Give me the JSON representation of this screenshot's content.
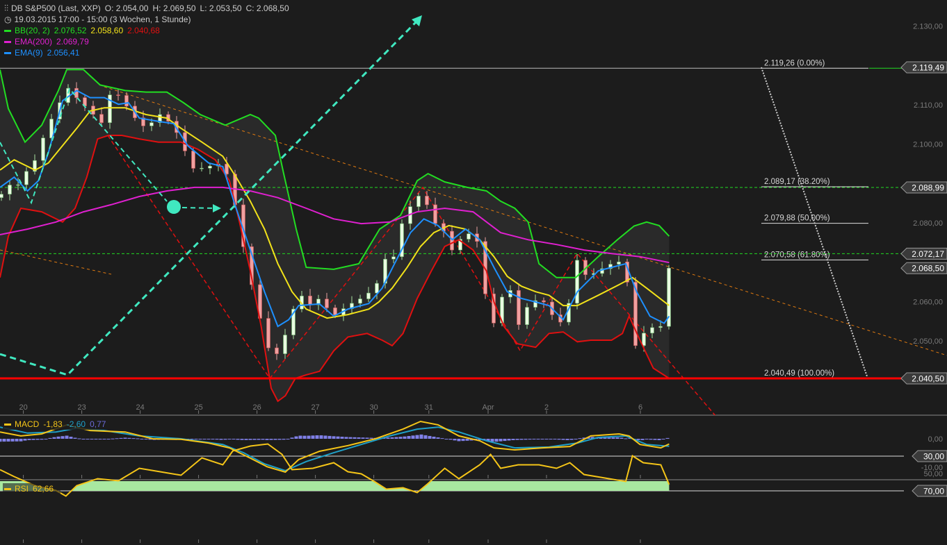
{
  "header": {
    "instrument": "DB S&P500 (Last, XXP)",
    "open": "O: 2.054,00",
    "high": "H: 2.069,50",
    "low": "L: 2.053,50",
    "close": "C: 2.068,50",
    "period": "19.03.2015 17:00 - 15:00 (3 Wochen, 1 Stunde)"
  },
  "indicators": {
    "bb": {
      "label": "BB(20, 2)",
      "upper": "2.076,52",
      "mid": "2.058,60",
      "lower": "2.040,68"
    },
    "ema200": {
      "label": "EMA(200)",
      "value": "2.069,79"
    },
    "ema9": {
      "label": "EMA(9)",
      "value": "2.056,41"
    },
    "macd": {
      "label": "MACD",
      "macd": "-1,83",
      "signal": "-2,60",
      "hist": "0,77"
    },
    "rsi": {
      "label": "RSI",
      "value": "62,66"
    }
  },
  "colors": {
    "bg": "#1c1c1c",
    "bb_upper": "#22dd22",
    "bb_mid": "#f2e21a",
    "bb_lower": "#e01010",
    "ema200": "#e020d0",
    "ema9": "#1e90ff",
    "macd": "#f5c518",
    "signal": "#1fa0c8",
    "hist": "#8080e8",
    "rsi": "#f5c518",
    "cyan": "#40e8c0"
  },
  "price_axis": {
    "ticks": [
      "2.130,00",
      "2.110,00",
      "2.100,00",
      "2.080,00",
      "2.060,00",
      "2.050,00"
    ],
    "tick_values": [
      2130,
      2110,
      2100,
      2080,
      2060,
      2050
    ]
  },
  "price_tags": [
    {
      "text": "2.119,49",
      "value": 2119.49
    },
    {
      "text": "2.088,99",
      "value": 2088.99
    },
    {
      "text": "2.072,17",
      "value": 2072.17
    },
    {
      "text": "2.068,50",
      "value": 2068.5
    },
    {
      "text": "2.040,50",
      "value": 2040.5
    }
  ],
  "fib_levels": [
    {
      "text": "2.119,26 (0.00%)",
      "value": 2119.26
    },
    {
      "text": "2.089,17 (38.20%)",
      "value": 2089.17
    },
    {
      "text": "2.079,88 (50,00%)",
      "value": 2079.88
    },
    {
      "text": "2.070,58 (61.80%)",
      "value": 2070.58
    },
    {
      "text": "2.040,49 (100.00%)",
      "value": 2040.49
    }
  ],
  "x_axis": {
    "labels": [
      "20",
      "23",
      "24",
      "25",
      "26",
      "27",
      "30",
      "31",
      "Apr",
      "2",
      "6"
    ],
    "label_bars": [
      2.8,
      9.8,
      16.8,
      23.8,
      30.8,
      37.8,
      44.8,
      51.4,
      58.5,
      65.5,
      76.75
    ]
  },
  "macd_axis": {
    "ticks": [
      "0,00",
      "-10,00"
    ],
    "tick_values": [
      0,
      -10
    ]
  },
  "rsi_axis": {
    "ticks": [
      "70,00",
      "50,00",
      "30,00"
    ],
    "tick_values": [
      70,
      50,
      30
    ]
  },
  "chart_data": {
    "type": "line",
    "title": "DB S&P500 (Last, XXP) 1h",
    "x_unit": "bar (1 hour)",
    "ylim": [
      2031,
      2135
    ],
    "bb_upper": [
      [
        0,
        2118.9
      ],
      [
        1,
        2109
      ],
      [
        3,
        2100.5
      ],
      [
        5,
        2104.8
      ],
      [
        7,
        2113.6
      ],
      [
        8,
        2118.9
      ],
      [
        10,
        2118.9
      ],
      [
        12,
        2115
      ],
      [
        15,
        2113.6
      ],
      [
        17.5,
        2113.2
      ],
      [
        20,
        2113.2
      ],
      [
        22,
        2110.5
      ],
      [
        24,
        2107.5
      ],
      [
        27,
        2104.8
      ],
      [
        29,
        2106.6
      ],
      [
        30,
        2107.5
      ],
      [
        31,
        2106.6
      ],
      [
        33,
        2102.2
      ],
      [
        34,
        2092.5
      ],
      [
        35.5,
        2078.4
      ],
      [
        36.7,
        2068.7
      ],
      [
        40,
        2068.2
      ],
      [
        43,
        2069.6
      ],
      [
        45.5,
        2078.4
      ],
      [
        48,
        2081.9
      ],
      [
        50,
        2090.7
      ],
      [
        51.3,
        2092.5
      ],
      [
        53.3,
        2090.4
      ],
      [
        56,
        2089
      ],
      [
        58.3,
        2088.1
      ],
      [
        60,
        2085.5
      ],
      [
        61.7,
        2083.7
      ],
      [
        63.3,
        2080.2
      ],
      [
        64.6,
        2069.6
      ],
      [
        66.7,
        2066.1
      ],
      [
        69,
        2066.1
      ],
      [
        71.7,
        2071.4
      ],
      [
        74,
        2075.7
      ],
      [
        76,
        2079.2
      ],
      [
        77.5,
        2080.2
      ],
      [
        79,
        2079.3
      ],
      [
        80.2,
        2076.6
      ]
    ],
    "bb_lower": [
      [
        0,
        2066.1
      ],
      [
        1,
        2076.6
      ],
      [
        2.5,
        2083.7
      ],
      [
        5,
        2082.8
      ],
      [
        7.5,
        2080.2
      ],
      [
        9,
        2083.7
      ],
      [
        10.4,
        2091.6
      ],
      [
        11.7,
        2101.3
      ],
      [
        13,
        2102.2
      ],
      [
        14.6,
        2102.2
      ],
      [
        16.7,
        2101.3
      ],
      [
        19,
        2100.5
      ],
      [
        21.7,
        2100.5
      ],
      [
        23.7,
        2098.7
      ],
      [
        25.8,
        2096
      ],
      [
        27.5,
        2090.7
      ],
      [
        28.7,
        2080.2
      ],
      [
        30,
        2067.8
      ],
      [
        31.3,
        2053.7
      ],
      [
        32.5,
        2038
      ],
      [
        33.3,
        2034.7
      ],
      [
        34.2,
        2036.1
      ],
      [
        35.4,
        2040.5
      ],
      [
        36.7,
        2041.4
      ],
      [
        38.3,
        2042.3
      ],
      [
        40,
        2047.5
      ],
      [
        41.7,
        2051
      ],
      [
        44,
        2051.9
      ],
      [
        45.8,
        2050.2
      ],
      [
        47,
        2048.8
      ],
      [
        48.3,
        2051.9
      ],
      [
        50,
        2060.8
      ],
      [
        51.7,
        2067.8
      ],
      [
        53.3,
        2074
      ],
      [
        55,
        2075.7
      ],
      [
        56.7,
        2073.1
      ],
      [
        58.3,
        2067.8
      ],
      [
        59.2,
        2059.9
      ],
      [
        60.4,
        2053.7
      ],
      [
        62,
        2049.3
      ],
      [
        64.2,
        2048.4
      ],
      [
        65.8,
        2051.9
      ],
      [
        67.5,
        2052.3
      ],
      [
        69.2,
        2049.8
      ],
      [
        70.8,
        2050.2
      ],
      [
        73.3,
        2050.2
      ],
      [
        74.6,
        2051.9
      ],
      [
        75.4,
        2056.3
      ],
      [
        76.7,
        2050.2
      ],
      [
        78.3,
        2043.1
      ],
      [
        80.2,
        2040.5
      ]
    ],
    "bb_mid": [
      [
        0,
        2093.4
      ],
      [
        1.7,
        2096
      ],
      [
        4.2,
        2093.4
      ],
      [
        5.8,
        2095.2
      ],
      [
        7.5,
        2099.6
      ],
      [
        9.2,
        2104
      ],
      [
        10.8,
        2108.4
      ],
      [
        12.5,
        2109.2
      ],
      [
        15,
        2109.2
      ],
      [
        17.5,
        2107.5
      ],
      [
        20,
        2106.6
      ],
      [
        21.7,
        2104
      ],
      [
        24.2,
        2100.5
      ],
      [
        26.7,
        2096.9
      ],
      [
        28.3,
        2091.6
      ],
      [
        30,
        2085.5
      ],
      [
        31.7,
        2078.4
      ],
      [
        33.3,
        2069.6
      ],
      [
        35,
        2062.5
      ],
      [
        36.7,
        2058.1
      ],
      [
        39.2,
        2055.8
      ],
      [
        41.7,
        2056.7
      ],
      [
        44.2,
        2058.1
      ],
      [
        45.4,
        2059.9
      ],
      [
        47,
        2063.4
      ],
      [
        48.8,
        2068.7
      ],
      [
        50.4,
        2074
      ],
      [
        52,
        2077.5
      ],
      [
        53.8,
        2079.3
      ],
      [
        55.8,
        2078.4
      ],
      [
        57.5,
        2075.7
      ],
      [
        59.2,
        2071.4
      ],
      [
        60.8,
        2066.4
      ],
      [
        62.5,
        2063.9
      ],
      [
        64.2,
        2062.5
      ],
      [
        65.8,
        2061.6
      ],
      [
        67.5,
        2059
      ],
      [
        69.2,
        2059
      ],
      [
        71.7,
        2061.6
      ],
      [
        74.2,
        2064.3
      ],
      [
        75.8,
        2066.1
      ],
      [
        77.5,
        2063.4
      ],
      [
        80.2,
        2059
      ]
    ],
    "ema9": [
      [
        0,
        2089
      ],
      [
        1.7,
        2091.6
      ],
      [
        3.3,
        2088.1
      ],
      [
        4.6,
        2090.7
      ],
      [
        5.8,
        2097.8
      ],
      [
        7.5,
        2111
      ],
      [
        9.2,
        2113.6
      ],
      [
        10.8,
        2111.8
      ],
      [
        12.5,
        2111.8
      ],
      [
        14.2,
        2110.1
      ],
      [
        15.4,
        2110.5
      ],
      [
        16.7,
        2106.6
      ],
      [
        19.2,
        2105.7
      ],
      [
        20.8,
        2105.2
      ],
      [
        22.5,
        2099.6
      ],
      [
        25,
        2095.2
      ],
      [
        26.7,
        2094.3
      ],
      [
        28.3,
        2083.7
      ],
      [
        30,
        2073.1
      ],
      [
        31.7,
        2062.5
      ],
      [
        33.3,
        2053.7
      ],
      [
        34.6,
        2055.4
      ],
      [
        35.8,
        2059
      ],
      [
        38.3,
        2059.4
      ],
      [
        40,
        2056.3
      ],
      [
        41.7,
        2058.1
      ],
      [
        44.2,
        2059.5
      ],
      [
        45.8,
        2063.4
      ],
      [
        47.5,
        2070.5
      ],
      [
        49.2,
        2077.5
      ],
      [
        50.8,
        2081
      ],
      [
        52.5,
        2079.3
      ],
      [
        54.2,
        2075.7
      ],
      [
        55.8,
        2078.4
      ],
      [
        57.5,
        2075.7
      ],
      [
        59.2,
        2068.7
      ],
      [
        60.8,
        2062.5
      ],
      [
        62.5,
        2060.8
      ],
      [
        64.2,
        2059.9
      ],
      [
        65.8,
        2059
      ],
      [
        67.5,
        2055.4
      ],
      [
        69.2,
        2062.5
      ],
      [
        71.7,
        2067.8
      ],
      [
        73.3,
        2068.7
      ],
      [
        75,
        2069.6
      ],
      [
        76.3,
        2062.5
      ],
      [
        77.9,
        2056.3
      ],
      [
        79.6,
        2054.5
      ],
      [
        80.2,
        2056.3
      ]
    ],
    "ema200": [
      [
        0,
        2077
      ],
      [
        3.3,
        2078.4
      ],
      [
        6.7,
        2080.2
      ],
      [
        10,
        2082.8
      ],
      [
        13.3,
        2084.6
      ],
      [
        16.7,
        2086.7
      ],
      [
        20,
        2088.1
      ],
      [
        23.3,
        2089
      ],
      [
        26.7,
        2089
      ],
      [
        30,
        2088.1
      ],
      [
        33.3,
        2086.4
      ],
      [
        36.7,
        2083.7
      ],
      [
        40,
        2081
      ],
      [
        43.3,
        2079.8
      ],
      [
        46.7,
        2080.2
      ],
      [
        50,
        2082.8
      ],
      [
        53.3,
        2083.7
      ],
      [
        56.7,
        2082.8
      ],
      [
        60,
        2077.5
      ],
      [
        63.3,
        2075.7
      ],
      [
        66.7,
        2074.5
      ],
      [
        70,
        2073.1
      ],
      [
        73.3,
        2072.2
      ],
      [
        76.7,
        2071.4
      ],
      [
        80.2,
        2069.9
      ]
    ],
    "close": [
      [
        0,
        2086.4
      ],
      [
        0.8,
        2089.9
      ],
      [
        2,
        2089
      ],
      [
        3.3,
        2093.4
      ],
      [
        4.6,
        2096.9
      ],
      [
        5.4,
        2103.1
      ],
      [
        6.7,
        2108.4
      ],
      [
        7.5,
        2111.8
      ],
      [
        8.3,
        2114.5
      ],
      [
        9.2,
        2111.8
      ],
      [
        10.8,
        2108.4
      ],
      [
        12.5,
        2104.8
      ],
      [
        13.3,
        2113.6
      ],
      [
        14.6,
        2111.8
      ],
      [
        15.8,
        2107.5
      ],
      [
        17.5,
        2104
      ],
      [
        19.2,
        2107.5
      ],
      [
        20.8,
        2104.8
      ],
      [
        22.1,
        2098.7
      ],
      [
        23.3,
        2093.4
      ],
      [
        25,
        2094.3
      ],
      [
        26.7,
        2095.2
      ],
      [
        27.5,
        2090.7
      ],
      [
        28.3,
        2083.7
      ],
      [
        29.6,
        2069.6
      ],
      [
        30.8,
        2059
      ],
      [
        32.1,
        2048.4
      ],
      [
        33.3,
        2046.6
      ],
      [
        34.6,
        2053.7
      ],
      [
        35.8,
        2062.5
      ],
      [
        37.1,
        2059
      ],
      [
        38.3,
        2060.8
      ],
      [
        40,
        2056.3
      ],
      [
        41.7,
        2059
      ],
      [
        43.3,
        2060.8
      ],
      [
        45,
        2063.4
      ],
      [
        46.3,
        2071.4
      ],
      [
        47.5,
        2071.4
      ],
      [
        48.3,
        2081
      ],
      [
        49.6,
        2085.5
      ],
      [
        50.8,
        2088.1
      ],
      [
        51.7,
        2080.2
      ],
      [
        52.9,
        2079.3
      ],
      [
        54.2,
        2073.1
      ],
      [
        55.8,
        2077.5
      ],
      [
        57.1,
        2076.6
      ],
      [
        57.9,
        2066.1
      ],
      [
        58.8,
        2053.7
      ],
      [
        59.6,
        2055.4
      ],
      [
        60.8,
        2066.9
      ],
      [
        62.1,
        2053.7
      ],
      [
        63.3,
        2059
      ],
      [
        64.6,
        2060.8
      ],
      [
        65.8,
        2059
      ],
      [
        66.7,
        2053.7
      ],
      [
        67.9,
        2056.3
      ],
      [
        69.2,
        2070.5
      ],
      [
        70.4,
        2066.1
      ],
      [
        71.7,
        2067.8
      ],
      [
        73.3,
        2069.6
      ],
      [
        75,
        2070.5
      ],
      [
        75.7,
        2051
      ],
      [
        76.3,
        2048.4
      ],
      [
        77.5,
        2053.2
      ],
      [
        79.2,
        2053.7
      ],
      [
        80.2,
        2068.5
      ]
    ],
    "macd": [
      [
        0,
        2.4
      ],
      [
        2.5,
        1
      ],
      [
        5,
        1.7
      ],
      [
        8,
        4.9
      ],
      [
        10.8,
        2.9
      ],
      [
        15,
        2.4
      ],
      [
        18.3,
        0
      ],
      [
        21.7,
        -0.2
      ],
      [
        25,
        -1.5
      ],
      [
        27.5,
        -3.2
      ],
      [
        30,
        -6.8
      ],
      [
        32,
        -9.8
      ],
      [
        34.2,
        -11.7
      ],
      [
        35.8,
        -7.3
      ],
      [
        38.3,
        -4.4
      ],
      [
        41.7,
        -2.4
      ],
      [
        45,
        0
      ],
      [
        48.3,
        3.4
      ],
      [
        50.4,
        6.1
      ],
      [
        52.5,
        4.9
      ],
      [
        55,
        1
      ],
      [
        57.5,
        -0.7
      ],
      [
        59.2,
        -3.2
      ],
      [
        61.7,
        -3.9
      ],
      [
        65,
        -3.2
      ],
      [
        68.3,
        -2.7
      ],
      [
        70.8,
        1
      ],
      [
        74.2,
        1.7
      ],
      [
        75.4,
        1
      ],
      [
        76.7,
        -2
      ],
      [
        79.2,
        -3.2
      ],
      [
        80.2,
        -1.83
      ]
    ],
    "signal": [
      [
        0,
        4.1
      ],
      [
        3.3,
        2
      ],
      [
        6.7,
        2.4
      ],
      [
        9.2,
        3.7
      ],
      [
        12.5,
        2.9
      ],
      [
        16.7,
        1
      ],
      [
        21.7,
        0
      ],
      [
        26.7,
        -2
      ],
      [
        29.2,
        -4.9
      ],
      [
        31.7,
        -8.8
      ],
      [
        34.2,
        -11.2
      ],
      [
        36.7,
        -8
      ],
      [
        40,
        -4.9
      ],
      [
        43.3,
        -2
      ],
      [
        46.7,
        1
      ],
      [
        50,
        3.4
      ],
      [
        52.5,
        4.1
      ],
      [
        55,
        2.4
      ],
      [
        58.3,
        -0.7
      ],
      [
        61.7,
        -3.2
      ],
      [
        65.8,
        -2.9
      ],
      [
        69.2,
        -1.5
      ],
      [
        71.7,
        0.5
      ],
      [
        75,
        1
      ],
      [
        77.5,
        -2
      ],
      [
        80.2,
        -2.6
      ]
    ],
    "rsi": [
      [
        0,
        45.6
      ],
      [
        1.7,
        53.6
      ],
      [
        4.2,
        64
      ],
      [
        6.7,
        69.6
      ],
      [
        7.9,
        76
      ],
      [
        9.2,
        64
      ],
      [
        11.7,
        56
      ],
      [
        14.2,
        58.4
      ],
      [
        16.7,
        44
      ],
      [
        19.2,
        48
      ],
      [
        21.7,
        52
      ],
      [
        24.2,
        32
      ],
      [
        26.7,
        40
      ],
      [
        27.9,
        24
      ],
      [
        30,
        18.4
      ],
      [
        32.1,
        16
      ],
      [
        33.8,
        28
      ],
      [
        35,
        45.6
      ],
      [
        37.5,
        44
      ],
      [
        40,
        37.6
      ],
      [
        41.7,
        48
      ],
      [
        43.3,
        50.4
      ],
      [
        45,
        60
      ],
      [
        46.3,
        68
      ],
      [
        48.3,
        66.4
      ],
      [
        50,
        72
      ],
      [
        51.3,
        61.6
      ],
      [
        53.3,
        44
      ],
      [
        55,
        56
      ],
      [
        57.5,
        40
      ],
      [
        58.8,
        28
      ],
      [
        60,
        44
      ],
      [
        62.1,
        40
      ],
      [
        64.6,
        40
      ],
      [
        66.7,
        44
      ],
      [
        68.3,
        37.6
      ],
      [
        70,
        51.2
      ],
      [
        72.5,
        55.2
      ],
      [
        75,
        59.2
      ],
      [
        75.8,
        29.6
      ],
      [
        77.1,
        37.6
      ],
      [
        79.2,
        40
      ],
      [
        80.2,
        62.66
      ]
    ]
  }
}
